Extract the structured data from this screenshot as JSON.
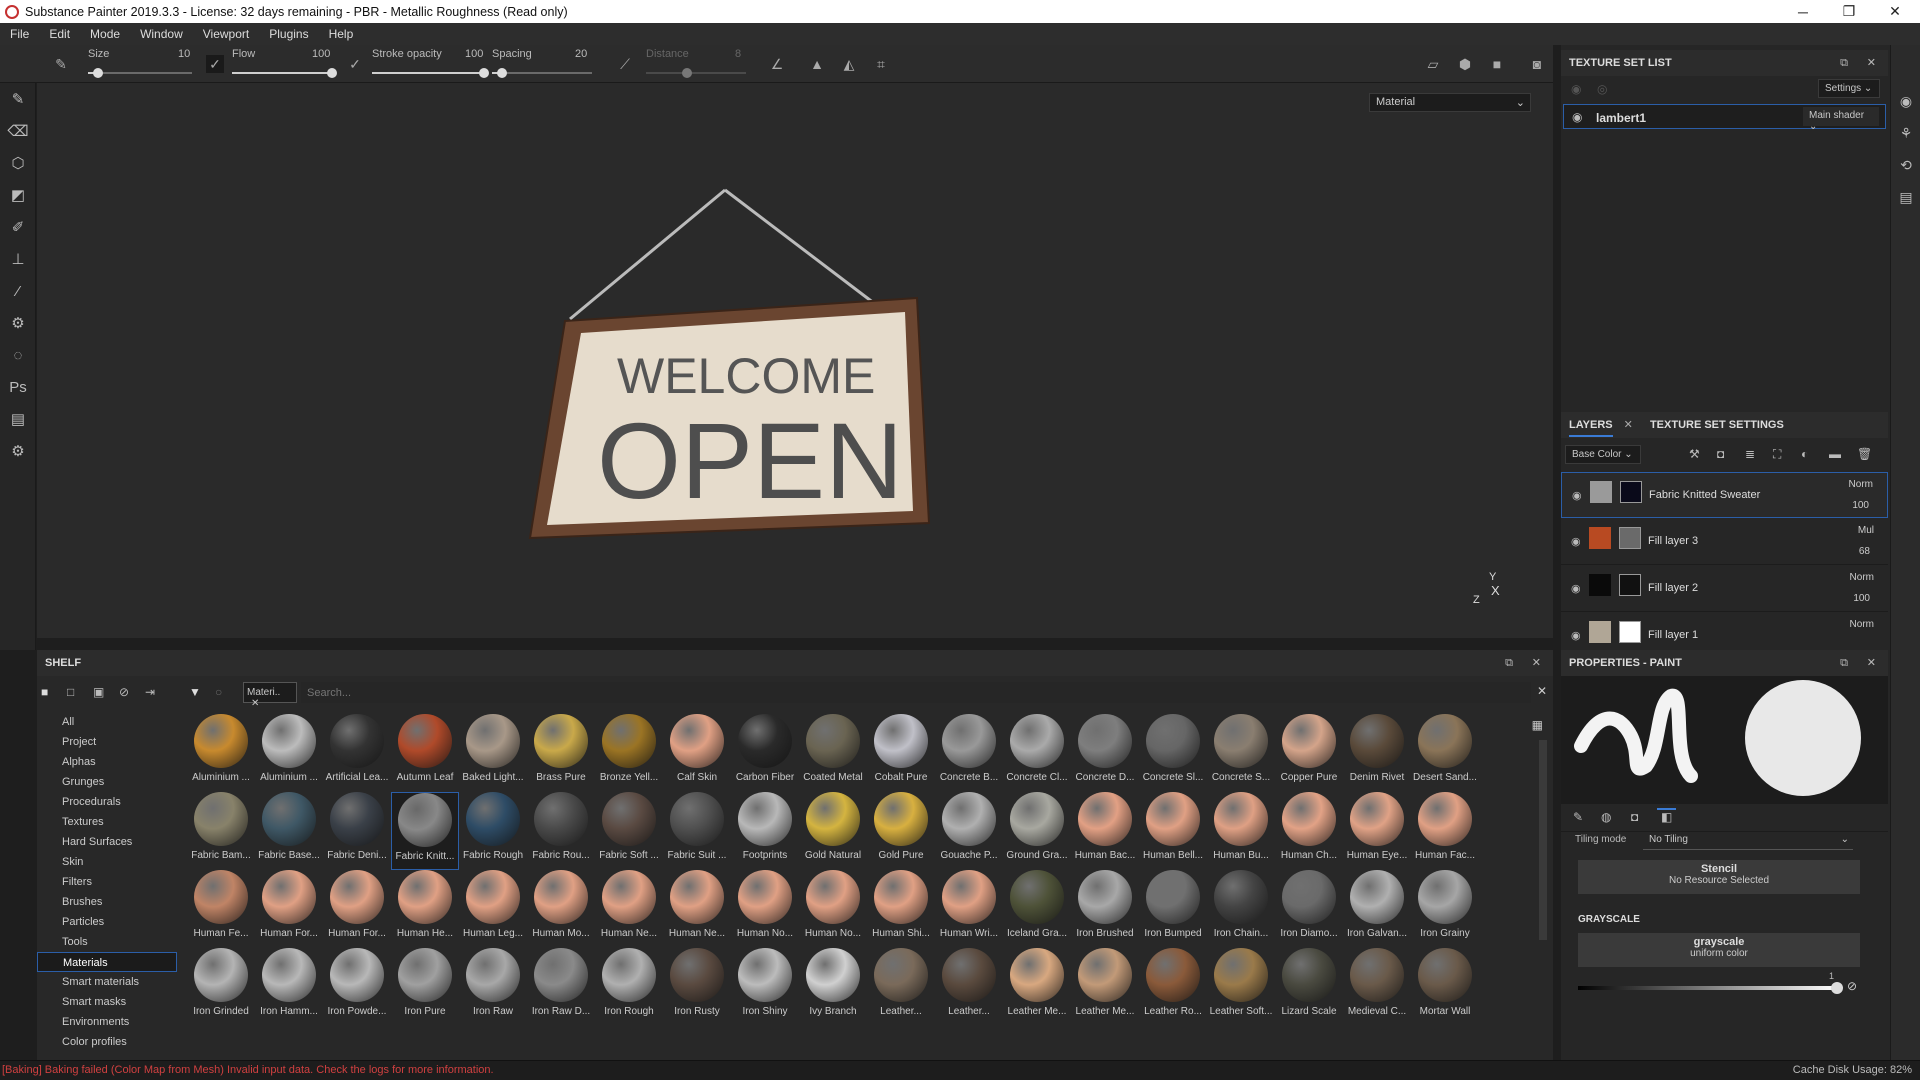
{
  "window": {
    "title": "Substance Painter 2019.3.3 - License: 32 days remaining - PBR - Metallic Roughness (Read only)",
    "minimize": "─",
    "maximize": "❐",
    "close": "✕"
  },
  "menu": [
    "File",
    "Edit",
    "Mode",
    "Window",
    "Viewport",
    "Plugins",
    "Help"
  ],
  "toolbar": {
    "size_label": "Size",
    "size_value": "10",
    "size_frac": 0.1,
    "flow_label": "Flow",
    "flow_value": "100",
    "flow_frac": 1.0,
    "stroke_label": "Stroke opacity",
    "stroke_value": "100",
    "stroke_frac": 1.0,
    "spacing_label": "Spacing",
    "spacing_value": "20",
    "spacing_frac": 0.1,
    "distance_label": "Distance",
    "distance_value": "8"
  },
  "viewport": {
    "material_select": "Material",
    "sign_line1": "WELCOME",
    "sign_line2": "OPEN",
    "axis_y": "Y",
    "axis_x": "X",
    "axis_z": "Z"
  },
  "texture_set_list": {
    "title": "TEXTURE SET LIST",
    "settings": "Settings",
    "item_name": "lambert1",
    "shader": "Main shader"
  },
  "layers_panel": {
    "tab_layers": "LAYERS",
    "tab_settings": "TEXTURE SET SETTINGS",
    "channel": "Base Color",
    "layers": [
      {
        "name": "Fabric Knitted Sweater",
        "blend": "Norm",
        "opacity": "100",
        "thumb": "#9a9a9a",
        "mask": "#0a0a1a"
      },
      {
        "name": "Fill layer 3",
        "blend": "Mul",
        "opacity": "68",
        "thumb": "#b84a22",
        "mask": "#6a6a6a"
      },
      {
        "name": "Fill layer 2",
        "blend": "Norm",
        "opacity": "100",
        "thumb": "#0a0a0a",
        "mask": "#111111"
      },
      {
        "name": "Fill layer 1",
        "blend": "Norm",
        "opacity": "",
        "thumb": "#b0a696",
        "mask": "#ffffff"
      }
    ]
  },
  "properties": {
    "title": "PROPERTIES - PAINT",
    "tiling_label": "Tiling mode",
    "tiling_value": "No Tiling",
    "stencil_title": "Stencil",
    "stencil_sub": "No Resource Selected",
    "grayscale_header": "GRAYSCALE",
    "grayscale_title": "grayscale",
    "grayscale_sub": "uniform color",
    "grayscale_value": "1"
  },
  "shelf": {
    "title": "SHELF",
    "filter_tag": "Materi..",
    "search_placeholder": "Search...",
    "categories": [
      "All",
      "Project",
      "Alphas",
      "Grunges",
      "Procedurals",
      "Textures",
      "Hard Surfaces",
      "Skin",
      "Filters",
      "Brushes",
      "Particles",
      "Tools",
      "Materials",
      "Smart materials",
      "Smart masks",
      "Environments",
      "Color profiles"
    ],
    "selected_category": "Materials",
    "materials": [
      {
        "label": "Aluminium ...",
        "color": "#c88a2e"
      },
      {
        "label": "Aluminium ...",
        "color": "#bcbcbc"
      },
      {
        "label": "Artificial Lea...",
        "color": "#333333"
      },
      {
        "label": "Autumn Leaf",
        "color": "#b04a2a"
      },
      {
        "label": "Baked Light...",
        "color": "#a89888"
      },
      {
        "label": "Brass Pure",
        "color": "#c9a94a"
      },
      {
        "label": "Bronze Yell...",
        "color": "#9b7424"
      },
      {
        "label": "Calf Skin",
        "color": "#e0a084"
      },
      {
        "label": "Carbon Fiber",
        "color": "#2a2a2a"
      },
      {
        "label": "Coated Metal",
        "color": "#6a6452"
      },
      {
        "label": "Cobalt Pure",
        "color": "#c0c0c8"
      },
      {
        "label": "Concrete B...",
        "color": "#999999"
      },
      {
        "label": "Concrete Cl...",
        "color": "#aaaaaa"
      },
      {
        "label": "Concrete D...",
        "color": "#7e7e7e"
      },
      {
        "label": "Concrete Sl...",
        "color": "#666666"
      },
      {
        "label": "Concrete S...",
        "color": "#8a7e70"
      },
      {
        "label": "Copper Pure",
        "color": "#d4a48a"
      },
      {
        "label": "Denim Rivet",
        "color": "#5a4a3a"
      },
      {
        "label": "Desert Sand...",
        "color": "#8a7458"
      },
      {
        "label": "Fabric Bam...",
        "color": "#88826a"
      },
      {
        "label": "Fabric Base...",
        "color": "#3f5866"
      },
      {
        "label": "Fabric Deni...",
        "color": "#3a4048"
      },
      {
        "label": "Fabric Knitt...",
        "color": "#888888"
      },
      {
        "label": "Fabric Rough",
        "color": "#2e4c66"
      },
      {
        "label": "Fabric Rou...",
        "color": "#4a4a4a"
      },
      {
        "label": "Fabric Soft ...",
        "color": "#5a4a42"
      },
      {
        "label": "Fabric Suit ...",
        "color": "#505050"
      },
      {
        "label": "Footprints",
        "color": "#b8b8b8"
      },
      {
        "label": "Gold Natural",
        "color": "#d4b440"
      },
      {
        "label": "Gold Pure",
        "color": "#d8b040"
      },
      {
        "label": "Gouache P...",
        "color": "#b0b0b0"
      },
      {
        "label": "Ground Gra...",
        "color": "#a8a8a0"
      },
      {
        "label": "Human Bac...",
        "color": "#e2a084"
      },
      {
        "label": "Human Bell...",
        "color": "#e0a084"
      },
      {
        "label": "Human Bu...",
        "color": "#dfa084"
      },
      {
        "label": "Human Ch...",
        "color": "#e2a286"
      },
      {
        "label": "Human Eye...",
        "color": "#e0a286"
      },
      {
        "label": "Human Fac...",
        "color": "#e0a084"
      },
      {
        "label": "Human Fe...",
        "color": "#c08466"
      },
      {
        "label": "Human For...",
        "color": "#e0a084"
      },
      {
        "label": "Human For...",
        "color": "#e0a084"
      },
      {
        "label": "Human He...",
        "color": "#e0a084"
      },
      {
        "label": "Human Leg...",
        "color": "#e0a084"
      },
      {
        "label": "Human Mo...",
        "color": "#e0a084"
      },
      {
        "label": "Human Ne...",
        "color": "#e0a084"
      },
      {
        "label": "Human Ne...",
        "color": "#e0a084"
      },
      {
        "label": "Human No...",
        "color": "#e0a084"
      },
      {
        "label": "Human No...",
        "color": "#e0a084"
      },
      {
        "label": "Human Shi...",
        "color": "#e0a084"
      },
      {
        "label": "Human Wri...",
        "color": "#e0a084"
      },
      {
        "label": "Iceland Gra...",
        "color": "#4e5238"
      },
      {
        "label": "Iron Brushed",
        "color": "#a8a8a8"
      },
      {
        "label": "Iron Bumped",
        "color": "#707070"
      },
      {
        "label": "Iron Chain...",
        "color": "#444444"
      },
      {
        "label": "Iron Diamo...",
        "color": "#6a6a6a"
      },
      {
        "label": "Iron Galvan...",
        "color": "#b0b0b0"
      },
      {
        "label": "Iron Grainy",
        "color": "#a6a6a6"
      },
      {
        "label": "Iron Grinded",
        "color": "#b4b4b4"
      },
      {
        "label": "Iron Hamm...",
        "color": "#b8b8b8"
      },
      {
        "label": "Iron Powde...",
        "color": "#b8b8b8"
      },
      {
        "label": "Iron Pure",
        "color": "#a0a0a0"
      },
      {
        "label": "Iron Raw",
        "color": "#a8a8a8"
      },
      {
        "label": "Iron Raw D...",
        "color": "#8a8a8a"
      },
      {
        "label": "Iron Rough",
        "color": "#b0b0b0"
      },
      {
        "label": "Iron Rusty",
        "color": "#5a4a40"
      },
      {
        "label": "Iron Shiny",
        "color": "#bcbcbc"
      },
      {
        "label": "Ivy Branch",
        "color": "#d0d0d0"
      },
      {
        "label": "Leather...",
        "color": "#7a6a5a"
      },
      {
        "label": "Leather...",
        "color": "#5a4a3e"
      },
      {
        "label": "Leather Me...",
        "color": "#d8a880"
      },
      {
        "label": "Leather Me...",
        "color": "#c29a78"
      },
      {
        "label": "Leather Ro...",
        "color": "#8a5a3a"
      },
      {
        "label": "Leather Soft...",
        "color": "#9a7a4a"
      },
      {
        "label": "Lizard Scale",
        "color": "#4a4a40"
      },
      {
        "label": "Medieval C...",
        "color": "#6a5a4a"
      },
      {
        "label": "Mortar Wall",
        "color": "#6a5a4a"
      }
    ]
  },
  "statusbar": {
    "error": "[Baking] Baking failed (Color Map from Mesh) Invalid input data. Check the logs for more information.",
    "cache": "Cache Disk Usage:  82%"
  }
}
